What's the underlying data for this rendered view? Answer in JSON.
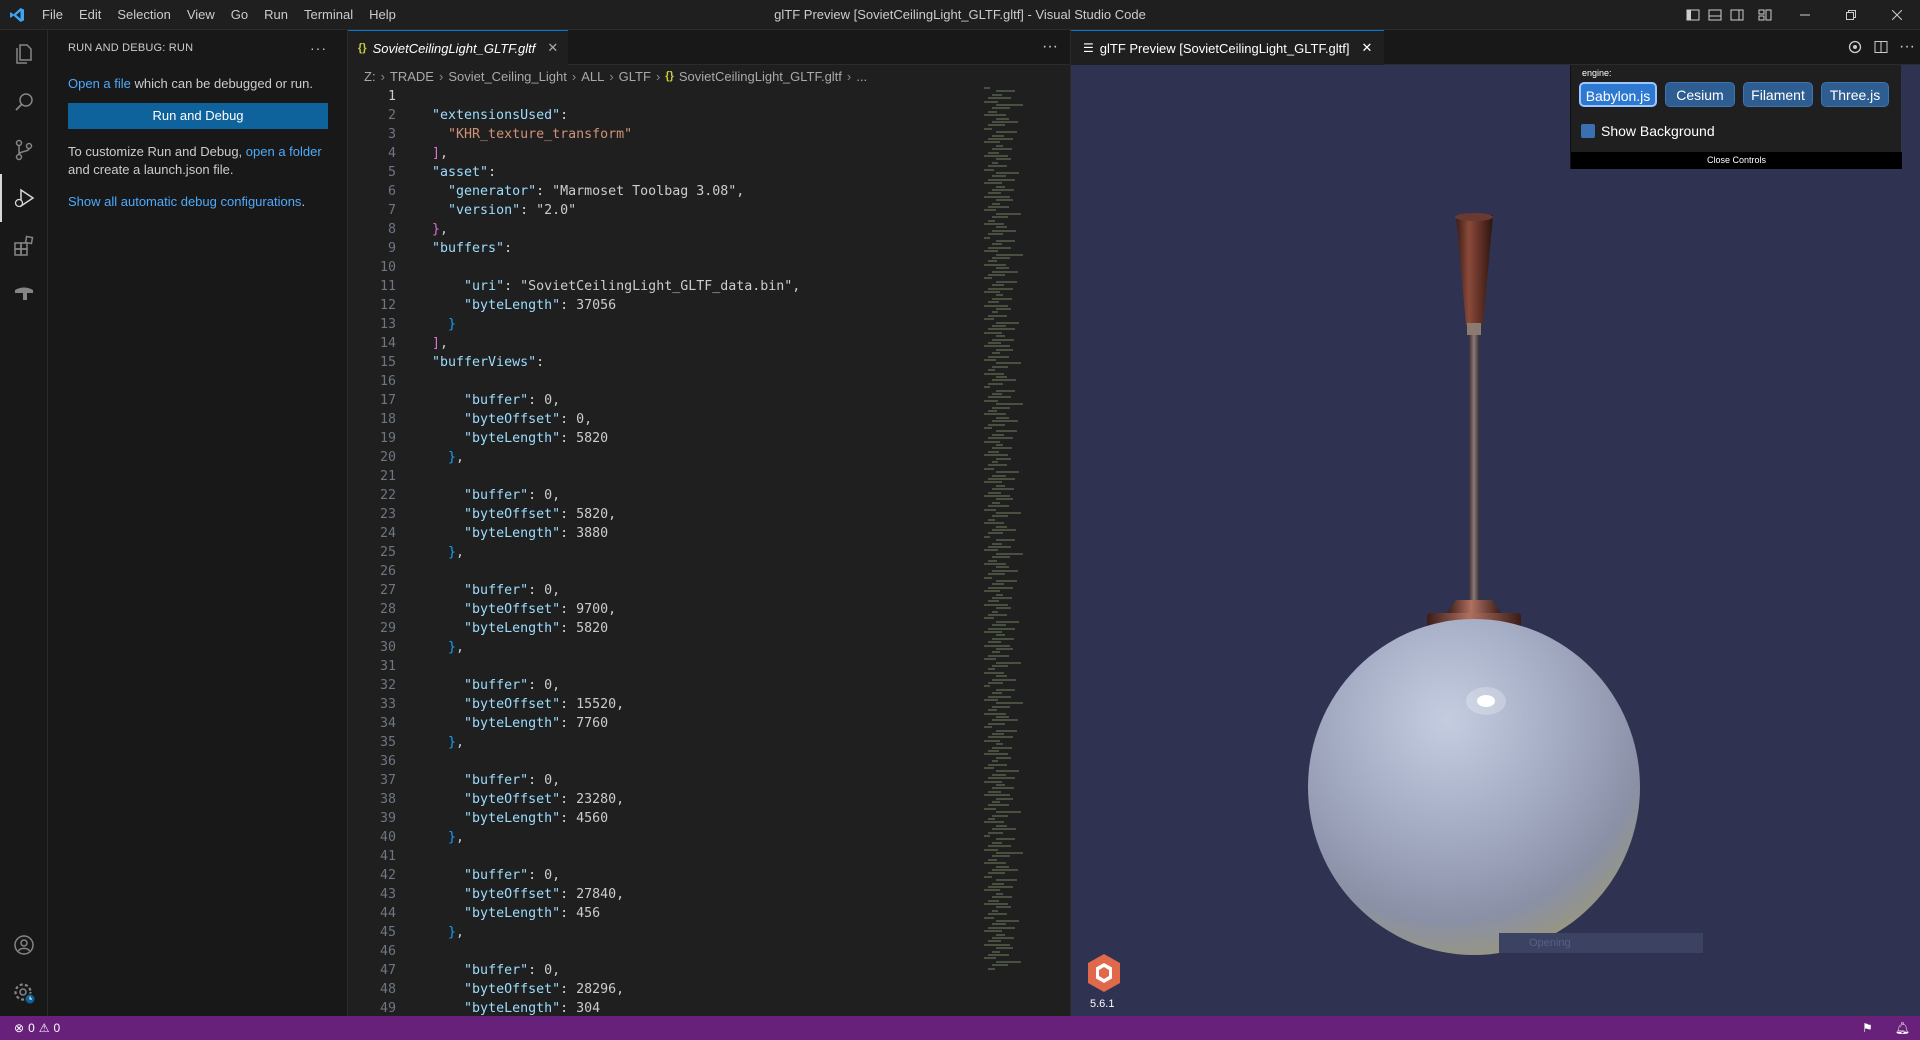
{
  "window": {
    "title": "glTF Preview [SovietCeilingLight_GLTF.gltf] - Visual Studio Code",
    "menu": [
      "File",
      "Edit",
      "Selection",
      "View",
      "Go",
      "Run",
      "Terminal",
      "Help"
    ]
  },
  "sidebar": {
    "title": "RUN AND DEBUG: RUN",
    "open_file_link": "Open a file",
    "open_file_text": " which can be debugged or run.",
    "run_button": "Run and Debug",
    "customize_text": "To customize Run and Debug, ",
    "open_folder_link": "open a folder",
    "customize_text2": "and create a launch.json file.",
    "show_all_link": "Show all automatic debug configurations",
    "show_all_suffix": "."
  },
  "editor": {
    "tab_label": "SovietCeilingLight_GLTF.gltf",
    "tab_icon": "{}",
    "breadcrumb": [
      "Z:",
      "TRADE",
      "Soviet_Ceiling_Light",
      "ALL",
      "GLTF",
      "SovietCeilingLight_GLTF.gltf",
      "..."
    ],
    "current_line": 1,
    "lines": [
      "{",
      "  \"extensionsUsed\": [",
      "    \"KHR_texture_transform\"",
      "  ],",
      "  \"asset\": {",
      "    \"generator\": \"Marmoset Toolbag 3.08\",",
      "    \"version\": \"2.0\"",
      "  },",
      "  \"buffers\": [",
      "    {",
      "      \"uri\": \"SovietCeilingLight_GLTF_data.bin\",",
      "      \"byteLength\": 37056",
      "    }",
      "  ],",
      "  \"bufferViews\": [",
      "    {",
      "      \"buffer\": 0,",
      "      \"byteOffset\": 0,",
      "      \"byteLength\": 5820",
      "    },",
      "    {",
      "      \"buffer\": 0,",
      "      \"byteOffset\": 5820,",
      "      \"byteLength\": 3880",
      "    },",
      "    {",
      "      \"buffer\": 0,",
      "      \"byteOffset\": 9700,",
      "      \"byteLength\": 5820",
      "    },",
      "    {",
      "      \"buffer\": 0,",
      "      \"byteOffset\": 15520,",
      "      \"byteLength\": 7760",
      "    },",
      "    {",
      "      \"buffer\": 0,",
      "      \"byteOffset\": 23280,",
      "      \"byteLength\": 4560",
      "    },",
      "    {",
      "      \"buffer\": 0,",
      "      \"byteOffset\": 27840,",
      "      \"byteLength\": 456",
      "    },",
      "    {",
      "      \"buffer\": 0,",
      "      \"byteOffset\": 28296,",
      "      \"byteLength\": 304"
    ]
  },
  "preview": {
    "tab_label": "glTF Preview [SovietCeilingLight_GLTF.gltf]",
    "engine_label": "engine:",
    "engines": [
      "Babylon.js",
      "Cesium",
      "Filament",
      "Three.js"
    ],
    "selected_engine": "Babylon.js",
    "show_background_label": "Show Background",
    "close_controls_label": "Close Controls",
    "loading_label": "Opening",
    "babylon_version": "5.6.1"
  },
  "statusbar": {
    "errors": "0",
    "warnings": "0",
    "color": "#68217a"
  },
  "colors": {
    "accent": "#0078d4",
    "button": "#0e639c",
    "link": "#4daafc"
  }
}
